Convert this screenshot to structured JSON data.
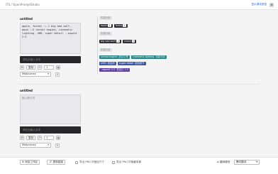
{
  "header": {
    "title": "ITS / OpenPromptStudio",
    "link": "显示调试按钮",
    "settings_icon": "gear-icon"
  },
  "cards": [
    {
      "title": "untitled",
      "prompt_text": "apple, forest ::-1 big bad wolf, mood ::2 unreal engine, cinematic lighting, UHD, super detail --aspect 2:3",
      "placeholder": "",
      "input_placeholder": "请在此输入文本",
      "copy_label": "复制",
      "num_value": "1",
      "model": "Midjourney"
    },
    {
      "title": "untitled",
      "prompt_text": "",
      "placeholder": "输入提示词",
      "input_placeholder": "请在此输入文本",
      "copy_label": "复制",
      "num_value": "1",
      "model": "Midjourney"
    }
  ],
  "tags": {
    "group_label_1": "权重分组",
    "apple": "apple",
    "apple_badge": "1",
    "forest": "forest",
    "forest_badge": "2",
    "group_label_2": "权重分组",
    "wolf": "big bad wolf",
    "wolf_badge": "-1",
    "mood": "mood",
    "mood_badge": "3",
    "group_label_3": "权重分组",
    "unreal": "unreal engine",
    "unreal_sub": "虚幻引擎",
    "cinematic": "cinematic lighting",
    "cinematic_sub": "电影光效",
    "uhd": "UHD",
    "uhd_sub": "超高清",
    "superdetail": "super detail",
    "superdetail_sub": "超级细节",
    "aspect": "--aspect 2:3",
    "aspect_sub": "宽高比 2:3"
  },
  "footer": {
    "add_workspace": "添加工作区",
    "copy_link": "复制链接",
    "export_png_fixed": "导出 PNG 时固定尺寸",
    "export_png_no_bg": "导出 PNG 时隐藏背景",
    "translate_label": "翻译服务",
    "translate_value": "腾讯翻译"
  }
}
